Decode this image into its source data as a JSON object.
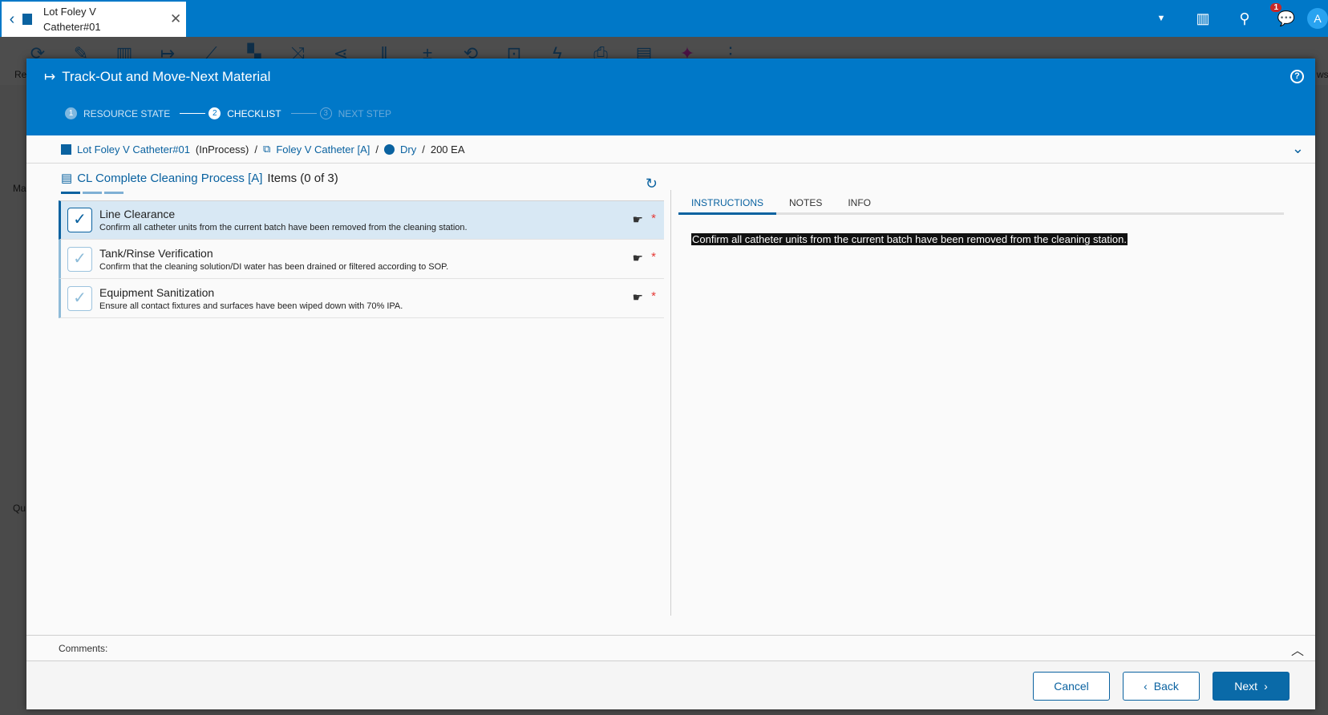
{
  "app_tab": {
    "title_line1": "Lot Foley V",
    "title_line2": "Catheter#01"
  },
  "topbar": {
    "notification_count": "1",
    "avatar": "A"
  },
  "background": {
    "left_labels": [
      "Re",
      "Ma",
      "Qu"
    ],
    "right_labels": [
      "ws"
    ]
  },
  "dialog": {
    "title": "Track-Out and Move-Next Material",
    "steps": [
      {
        "num": "1",
        "label": "RESOURCE STATE"
      },
      {
        "num": "2",
        "label": "CHECKLIST"
      },
      {
        "num": "3",
        "label": "NEXT STEP"
      }
    ],
    "breadcrumb": {
      "lot": "Lot Foley V Catheter#01",
      "state": "(InProcess)",
      "product": "Foley V Catheter [A]",
      "step": "Dry",
      "qty": "200 EA",
      "sep": "/"
    },
    "checklist": {
      "name": "CL Complete Cleaning Process [A]",
      "count": "Items (0 of 3)",
      "items": [
        {
          "title": "Line Clearance",
          "desc": "Confirm all catheter units from the current batch have been removed from the cleaning station."
        },
        {
          "title": "Tank/Rinse Verification",
          "desc": "Confirm that the cleaning solution/DI water has been drained or filtered according to SOP."
        },
        {
          "title": "Equipment Sanitization",
          "desc": "Ensure all contact fixtures and surfaces have been wiped down with 70% IPA."
        }
      ]
    },
    "tabs": [
      "INSTRUCTIONS",
      "NOTES",
      "INFO"
    ],
    "instruction_text": "Confirm all catheter units from the current batch have been removed from the cleaning station.",
    "comments_label": "Comments:",
    "buttons": {
      "cancel": "Cancel",
      "back": "Back",
      "next": "Next"
    }
  },
  "colors": {
    "brand": "#0078c8",
    "accent": "#0a62a0",
    "required": "#e53935"
  }
}
